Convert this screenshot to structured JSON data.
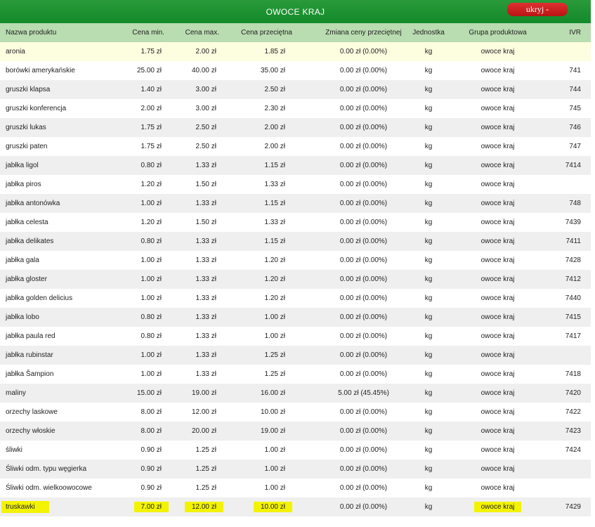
{
  "header": {
    "title": "OWOCE KRAJ",
    "hide_label": "ukryj -"
  },
  "columns": [
    "Nazwa produktu",
    "Cena min.",
    "Cena max.",
    "Cena przeciętna",
    "Zmiana ceny przeciętnej",
    "Jednostka",
    "Grupa produktowa",
    "IVR"
  ],
  "rows": [
    [
      "aronia",
      "1.75 zł",
      "2.00 zł",
      "1.85 zł",
      "0.00 zł (0.00%)",
      "kg",
      "owoce kraj",
      ""
    ],
    [
      "borówki amerykańskie",
      "25.00 zł",
      "40.00 zł",
      "35.00 zł",
      "0.00 zł (0.00%)",
      "kg",
      "owoce kraj",
      "741"
    ],
    [
      "gruszki klapsa",
      "1.40 zł",
      "3.00 zł",
      "2.50 zł",
      "0.00 zł (0.00%)",
      "kg",
      "owoce kraj",
      "744"
    ],
    [
      "gruszki konferencja",
      "2.00 zł",
      "3.00 zł",
      "2.30 zł",
      "0.00 zł (0.00%)",
      "kg",
      "owoce kraj",
      "745"
    ],
    [
      "gruszki lukas",
      "1.75 zł",
      "2.50 zł",
      "2.00 zł",
      "0.00 zł (0.00%)",
      "kg",
      "owoce kraj",
      "746"
    ],
    [
      "gruszki paten",
      "1.75 zł",
      "2.50 zł",
      "2.00 zł",
      "0.00 zł (0.00%)",
      "kg",
      "owoce kraj",
      "747"
    ],
    [
      "jabłka ligol",
      "0.80 zł",
      "1.33 zł",
      "1.15 zł",
      "0.00 zł (0.00%)",
      "kg",
      "owoce kraj",
      "7414"
    ],
    [
      "jabłka piros",
      "1.20 zł",
      "1.50 zł",
      "1.33 zł",
      "0.00 zł (0.00%)",
      "kg",
      "owoce kraj",
      ""
    ],
    [
      "jabłka antonówka",
      "1.00 zł",
      "1.33 zł",
      "1.15 zł",
      "0.00 zł (0.00%)",
      "kg",
      "owoce kraj",
      "748"
    ],
    [
      "jabłka celesta",
      "1.20 zł",
      "1.50 zł",
      "1.33 zł",
      "0.00 zł (0.00%)",
      "kg",
      "owoce kraj",
      "7439"
    ],
    [
      "jabłka delikates",
      "0.80 zł",
      "1.33 zł",
      "1.15 zł",
      "0.00 zł (0.00%)",
      "kg",
      "owoce kraj",
      "7411"
    ],
    [
      "jabłka gala",
      "1.00 zł",
      "1.33 zł",
      "1.20 zł",
      "0.00 zł (0.00%)",
      "kg",
      "owoce kraj",
      "7428"
    ],
    [
      "jabłka gloster",
      "1.00 zł",
      "1.33 zł",
      "1.20 zł",
      "0.00 zł (0.00%)",
      "kg",
      "owoce kraj",
      "7412"
    ],
    [
      "jabłka golden delicius",
      "1.00 zł",
      "1.33 zł",
      "1.20 zł",
      "0.00 zł (0.00%)",
      "kg",
      "owoce kraj",
      "7440"
    ],
    [
      "jabłka lobo",
      "0.80 zł",
      "1.33 zł",
      "1.00 zł",
      "0.00 zł (0.00%)",
      "kg",
      "owoce kraj",
      "7415"
    ],
    [
      "jabłka paula red",
      "0.80 zł",
      "1.33 zł",
      "1.00 zł",
      "0.00 zł (0.00%)",
      "kg",
      "owoce kraj",
      "7417"
    ],
    [
      "jabłka rubinstar",
      "1.00 zł",
      "1.33 zł",
      "1.25 zł",
      "0.00 zł (0.00%)",
      "kg",
      "owoce kraj",
      ""
    ],
    [
      "jabłka Šampion",
      "1.00 zł",
      "1.33 zł",
      "1.25 zł",
      "0.00 zł (0.00%)",
      "kg",
      "owoce kraj",
      "7418"
    ],
    [
      "maliny",
      "15.00 zł",
      "19.00 zł",
      "16.00 zł",
      "5.00 zł (45.45%)",
      "kg",
      "owoce kraj",
      "7420"
    ],
    [
      "orzechy laskowe",
      "8.00 zł",
      "12.00 zł",
      "10.00 zł",
      "0.00 zł (0.00%)",
      "kg",
      "owoce kraj",
      "7422"
    ],
    [
      "orzechy włoskie",
      "8.00 zł",
      "20.00 zł",
      "19.00 zł",
      "0.00 zł (0.00%)",
      "kg",
      "owoce kraj",
      "7423"
    ],
    [
      "śliwki",
      "0.90 zł",
      "1.25 zł",
      "1.00 zł",
      "0.00 zł (0.00%)",
      "kg",
      "owoce kraj",
      "7424"
    ],
    [
      "Śliwki odm. typu węgierka",
      "0.90 zł",
      "1.25 zł",
      "1.00 zł",
      "0.00 zł (0.00%)",
      "kg",
      "owoce kraj",
      ""
    ],
    [
      "Śliwki odm. wielkoowocowe",
      "0.90 zł",
      "1.25 zł",
      "1.00 zł",
      "0.00 zł (0.00%)",
      "kg",
      "owoce kraj",
      ""
    ],
    [
      "truskawki",
      "7.00 zł",
      "12.00 zł",
      "10.00 zł",
      "0.00 zł (0.00%)",
      "kg",
      "owoce kraj",
      "7429"
    ]
  ],
  "highlighted_row": 24,
  "colors": {
    "header_green": "#1a9230",
    "column_header_bg": "#b9dcb1",
    "highlight": "#f3f300",
    "hide_button": "#c81e1e"
  }
}
